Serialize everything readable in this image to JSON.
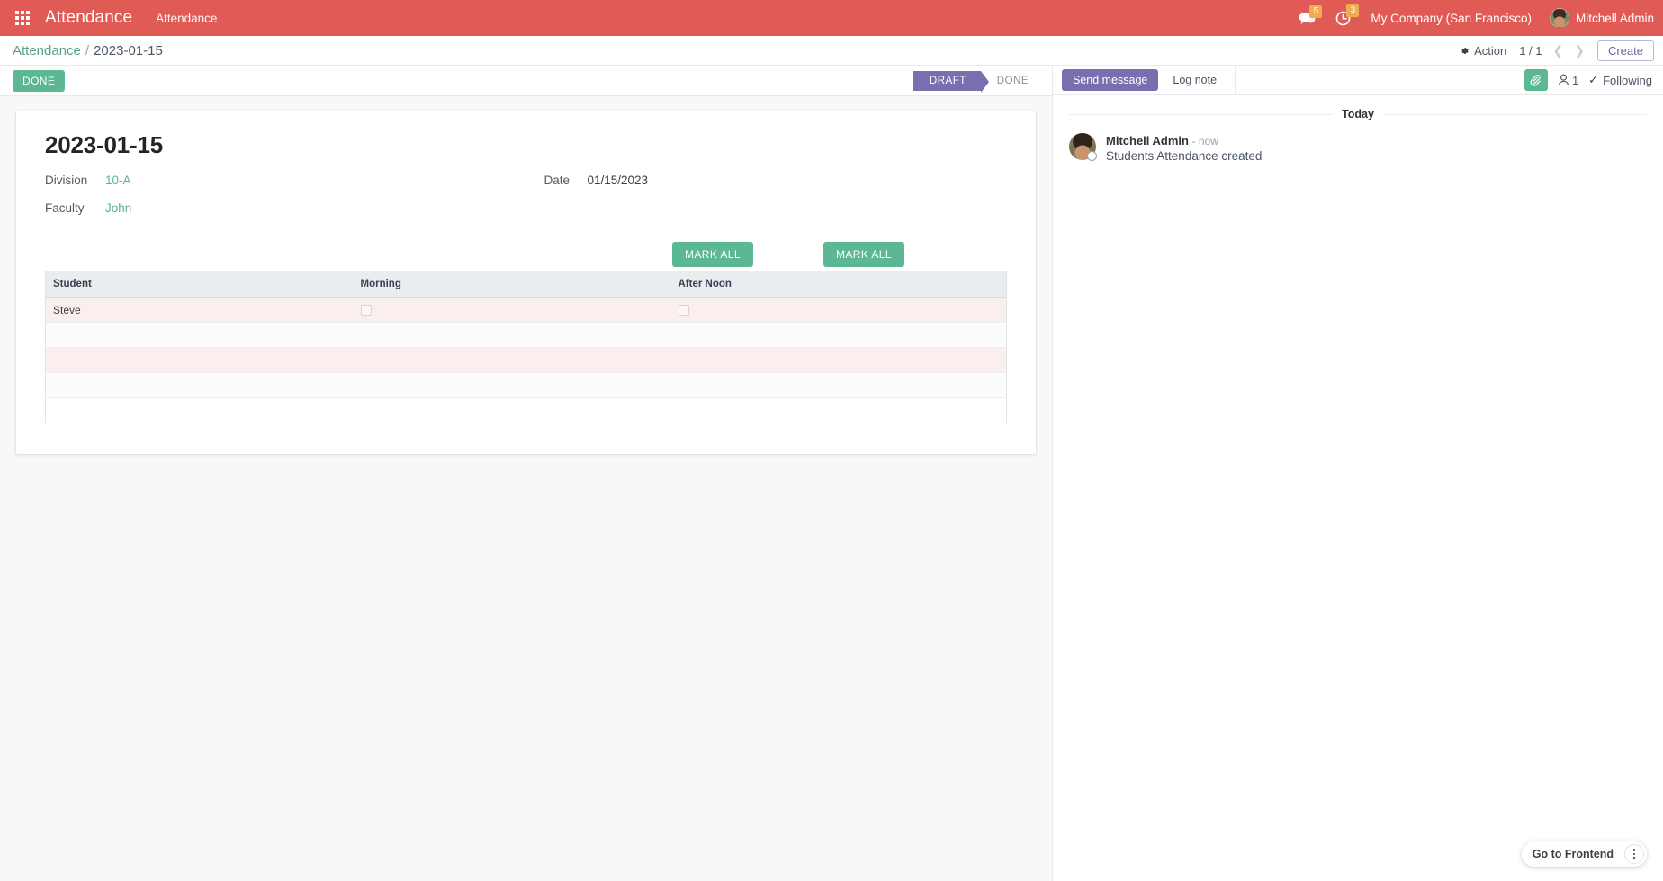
{
  "navbar": {
    "apps_icon": "apps-grid-icon",
    "brand": "Attendance",
    "menu_item": "Attendance",
    "messages": {
      "icon": "chat-bubble-icon",
      "count": "5"
    },
    "activities": {
      "icon": "clock-icon",
      "count": "3"
    },
    "company": "My Company (San Francisco)",
    "user": "Mitchell Admin"
  },
  "control_panel": {
    "breadcrumb_root": "Attendance",
    "breadcrumb_sep": "/",
    "breadcrumb_current": "2023-01-15",
    "action_label": "Action",
    "action_icon": "gear-icon",
    "pager": "1 / 1",
    "prev_icon": "chevron-left-icon",
    "next_icon": "chevron-right-icon",
    "create_label": "Create"
  },
  "statusbar": {
    "done_button": "DONE",
    "stages": [
      {
        "label": "DRAFT",
        "active": true
      },
      {
        "label": "DONE",
        "active": false
      }
    ]
  },
  "form": {
    "title": "2023-01-15",
    "fields": {
      "division_label": "Division",
      "division_value": "10-A",
      "date_label": "Date",
      "date_value": "01/15/2023",
      "faculty_label": "Faculty",
      "faculty_value": "John"
    },
    "mark_all_morning": "MARK ALL",
    "mark_all_afternoon": "MARK ALL",
    "table": {
      "columns": [
        "Student",
        "Morning",
        "After Noon"
      ],
      "rows": [
        {
          "student": "Steve",
          "morning_checked": false,
          "afternoon_checked": false
        }
      ],
      "empty_row_count": 4
    }
  },
  "chatter": {
    "send_message_label": "Send message",
    "log_note_label": "Log note",
    "attachment_icon": "paperclip-icon",
    "followers_icon": "user-icon",
    "followers_count": "1",
    "following_label": "Following",
    "following_icon": "check-icon",
    "day_separator": "Today",
    "messages": [
      {
        "author": "Mitchell Admin",
        "date": "- now",
        "text": "Students Attendance created"
      }
    ]
  },
  "frontend": {
    "label": "Go to Frontend",
    "more_icon": "dots-vertical-icon"
  },
  "colors": {
    "navbar": "#e15b56",
    "accent_green": "#5cb793",
    "accent_purple": "#7a6fae",
    "link_teal": "#5bae9c",
    "badge_orange": "#f0ad4e"
  }
}
